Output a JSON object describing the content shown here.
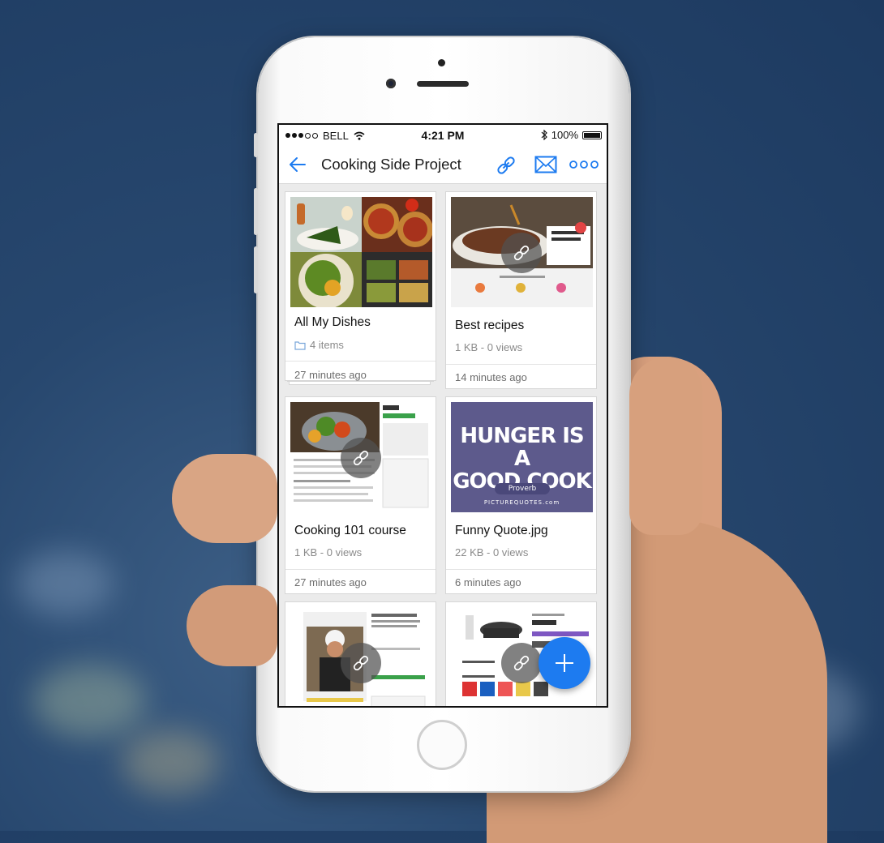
{
  "status_bar": {
    "carrier": "BELL",
    "time": "4:21 PM",
    "battery": "100%"
  },
  "nav": {
    "title": "Cooking Side Project",
    "back_icon": "back-arrow-icon",
    "link_icon": "link-icon",
    "mail_icon": "mail-icon",
    "more_icon": "more-icon"
  },
  "cards": [
    {
      "name": "All My Dishes",
      "meta": "4 items",
      "time": "27 minutes ago",
      "type": "folder"
    },
    {
      "name": "Best recipes",
      "meta": "1 KB - 0 views",
      "time": "14 minutes ago",
      "type": "link"
    },
    {
      "name": "Cooking 101 course",
      "meta": "1 KB - 0 views",
      "time": "27 minutes ago",
      "type": "link"
    },
    {
      "name": "Funny Quote.jpg",
      "meta": "22 KB - 0 views",
      "time": "6 minutes ago",
      "type": "image"
    }
  ],
  "quote_image": {
    "line1": "HUNGER IS A",
    "line2": "GOOD COOK",
    "tag": "Proverb",
    "source": "PICTUREQUOTES.com"
  },
  "colors": {
    "accent": "#1d7bf0",
    "background": "#1d3a60"
  }
}
